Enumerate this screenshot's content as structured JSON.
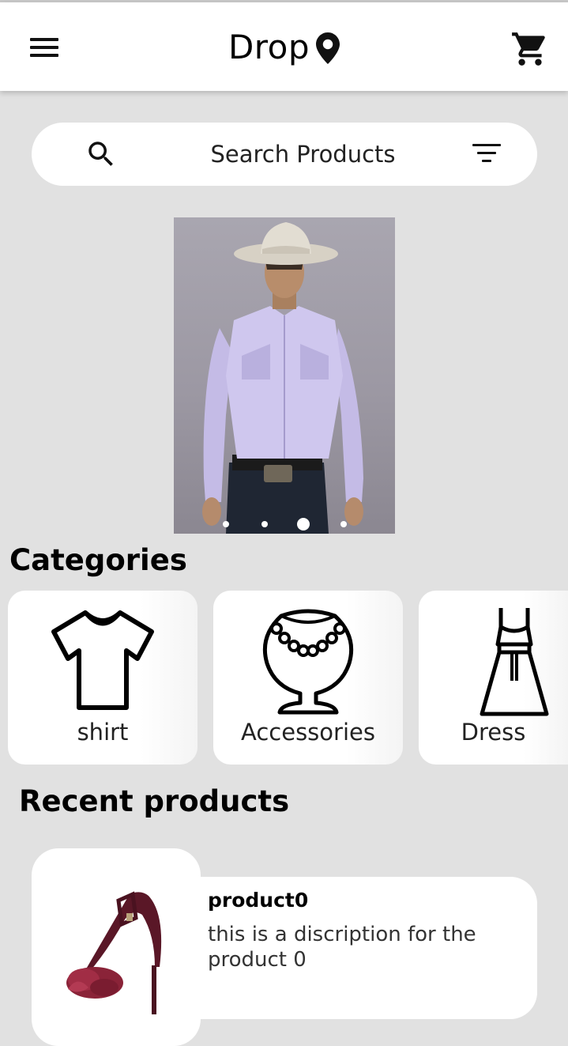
{
  "app_bar": {
    "title": "Drop",
    "menu_icon": "menu-icon",
    "location_icon": "location-pin-icon",
    "cart_icon": "shopping-cart-icon"
  },
  "search": {
    "placeholder": "Search Products",
    "search_icon": "search-icon",
    "filter_icon": "filter-icon"
  },
  "banner": {
    "image": "man-in-cowboy-hat-and-lavender-western-shirt",
    "dots_count": 4,
    "active_dot_index": 2
  },
  "categories": {
    "title": "Categories",
    "items": [
      {
        "label": "shirt",
        "icon": "t-shirt-icon"
      },
      {
        "label": "Accessories",
        "icon": "necklace-bust-icon"
      },
      {
        "label": "Dress",
        "icon": "dress-icon"
      }
    ]
  },
  "recent": {
    "title": "Recent products",
    "items": [
      {
        "name": "product0",
        "description": "this is a discription for the product 0",
        "image": "burgundy-fur-stiletto-sandal"
      }
    ]
  },
  "colors": {
    "background": "#e1e1e1",
    "card": "#ffffff",
    "text": "#000000"
  }
}
